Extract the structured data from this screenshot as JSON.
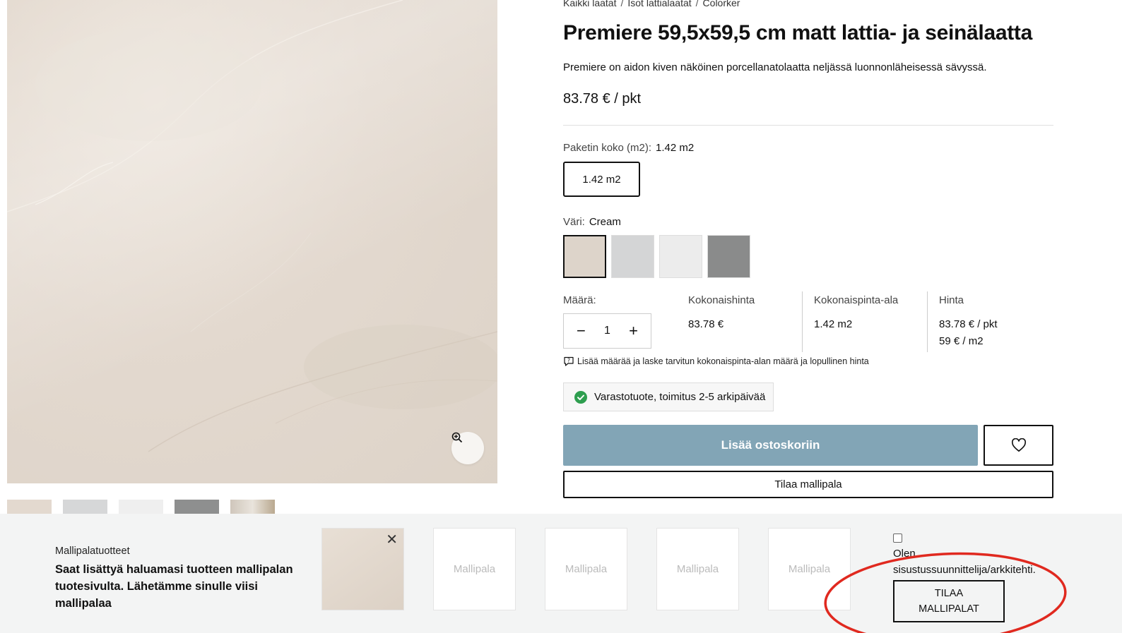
{
  "breadcrumb": [
    "Kaikki laatat",
    "Isot lattialaatat",
    "Colorker"
  ],
  "product": {
    "title": "Premiere 59,5x59,5 cm matt lattia- ja seinälaatta",
    "description": "Premiere on aidon kiven näköinen porcellanatolaatta neljässä luonnonläheisessä sävyssä.",
    "price": "83.78 € / pkt"
  },
  "package": {
    "label": "Paketin koko (m2):",
    "value": "1.42 m2",
    "option": "1.42 m2"
  },
  "color": {
    "label": "Väri:",
    "value": "Cream",
    "swatches": [
      "#ddd4ca",
      "#d4d5d6",
      "#ececec",
      "#8a8b8b"
    ]
  },
  "quantity": {
    "label": "Määrä:",
    "value": "1",
    "minus": "−",
    "plus": "+"
  },
  "totals": {
    "total_price_label": "Kokonaishinta",
    "total_price": "83.78 €",
    "total_area_label": "Kokonaispinta-ala",
    "total_area": "1.42 m2",
    "price_label": "Hinta",
    "price_pkt": "83.78 € / pkt",
    "price_m2": "59 € / m2"
  },
  "hint": "Lisää määrää ja laske tarvitun kokonaispinta-alan määrä ja lopullinen hinta",
  "stock": "Varastotuote, toimitus 2-5 arkipäivää",
  "buttons": {
    "add_to_cart": "Lisää ostoskoriin",
    "order_sample": "Tilaa mallipala"
  },
  "sample_bar": {
    "label": "Mallipalatuotteet",
    "text": "Saat lisättyä haluamasi tuotteen mallipalan tuotesivulta. Lähetämme sinulle viisi mallipalaa",
    "slot_placeholder": "Mallipala",
    "designer_label": "Olen sisustussuunnittelija/arkkitehti.",
    "order_button": "TILAA MALLIPALAT"
  },
  "colors": {
    "accent_button": "#82a5b6",
    "stock_ok": "#2e9e4f",
    "annotation": "#e0291f"
  }
}
